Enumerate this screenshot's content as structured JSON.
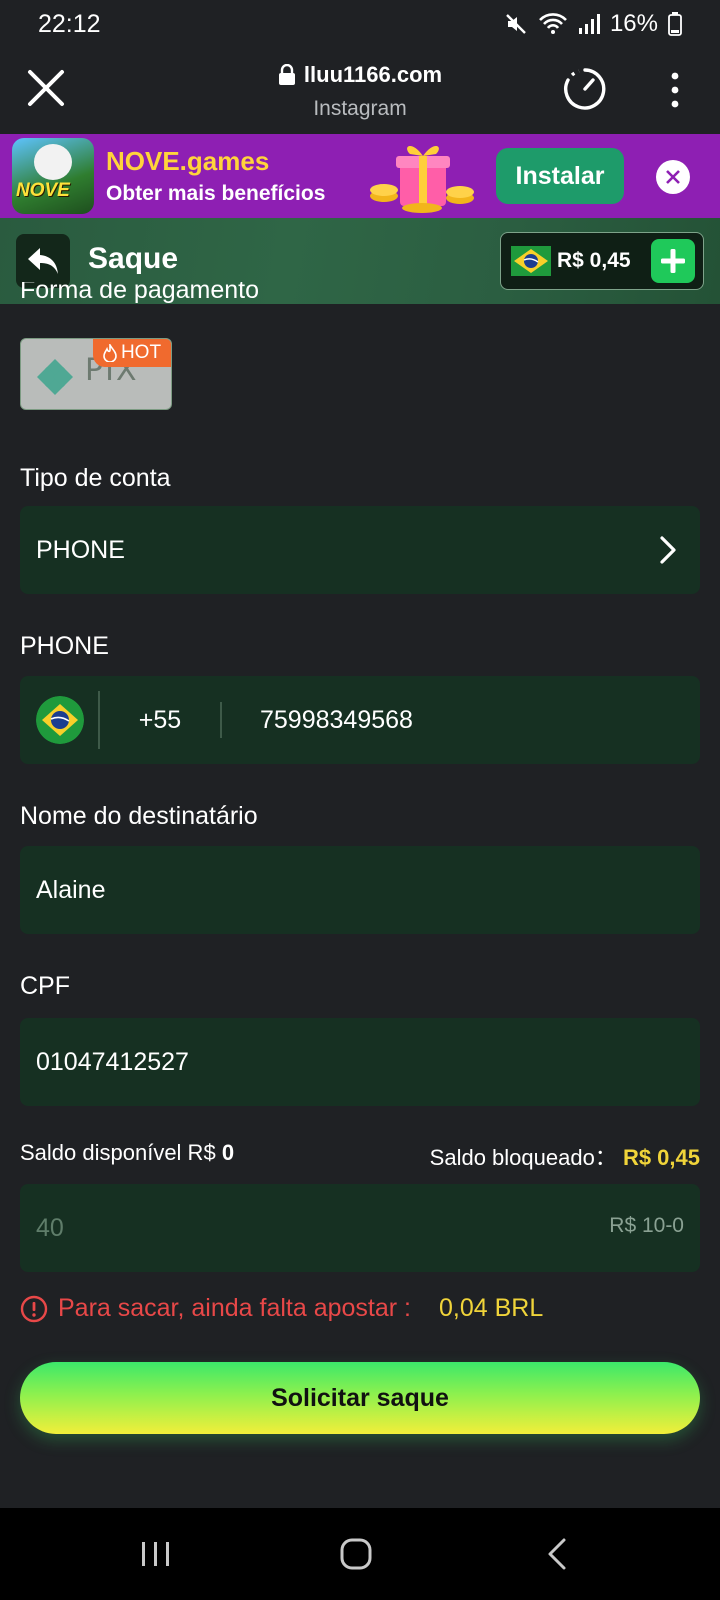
{
  "status": {
    "time": "22:12",
    "battery": "16%"
  },
  "browser": {
    "url": "lluu1166.com",
    "source": "Instagram"
  },
  "ad": {
    "title": "NOVE.games",
    "subtitle": "Obter mais benefícios",
    "install_label": "Instalar",
    "logo_text": "NOVE"
  },
  "header": {
    "title": "Saque",
    "balance": "R$ 0,45"
  },
  "form": {
    "payment_label": "Forma de pagamento",
    "payment_method": "PIX",
    "hot_label": "HOT",
    "account_type_label": "Tipo de conta",
    "account_type_value": "PHONE",
    "phone_label": "PHONE",
    "phone_code": "+55",
    "phone_number": "75998349568",
    "recipient_label": "Nome do destinatário",
    "recipient_value": "Alaine",
    "cpf_label": "CPF",
    "cpf_value": "01047412527",
    "available_label": "Saldo disponível R$",
    "available_value": "0",
    "blocked_label": "Saldo bloqueado：",
    "blocked_value": "R$ 0,45",
    "amount_placeholder": "40",
    "amount_hint": "R$ 10-0",
    "warning_text": "Para sacar, ainda falta apostar :",
    "warning_value": "0,04 BRL",
    "submit_label": "Solicitar saque"
  },
  "colors": {
    "accent_green": "#1fc95a",
    "field_bg": "#163022",
    "warn_red": "#e84848",
    "highlight_yellow": "#f0d43a",
    "ad_purple": "#8e1fb3"
  }
}
